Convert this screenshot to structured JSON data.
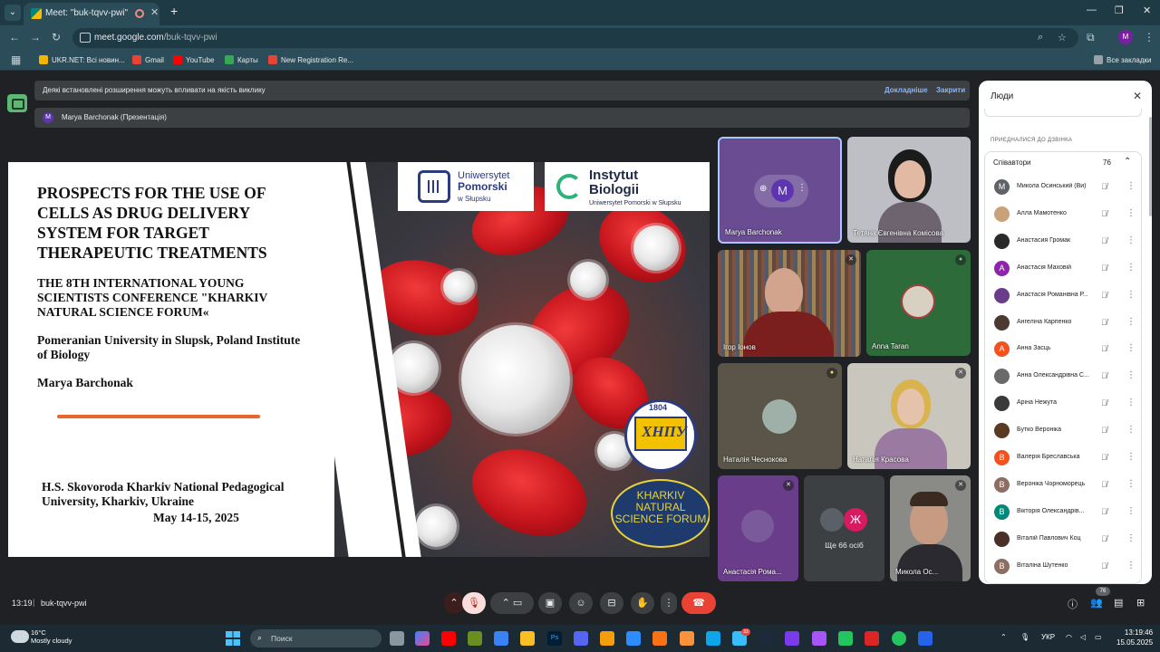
{
  "browser": {
    "tab_title": "Meet: \"buk-tqvv-pwi\"",
    "url_host": "meet.google.com",
    "url_path": "/buk-tqvv-pwi",
    "profile_initial": "M",
    "bookmarks": [
      {
        "label": "UKR.NET: Всі новин...",
        "color": "#f4b400"
      },
      {
        "label": "Gmail",
        "color": "#ea4335"
      },
      {
        "label": "YouTube",
        "color": "#ff0000"
      },
      {
        "label": "Карты",
        "color": "#34a853"
      },
      {
        "label": "New Registration Re...",
        "color": "#ea4335"
      }
    ],
    "all_bookmarks": "Все закладки"
  },
  "meet": {
    "notice_text": "Деякі встановлені розширення можуть впливати на якість виклику",
    "notice_more": "Докладніше",
    "notice_close": "Закрити",
    "presenter_initial": "M",
    "presenter_text": "Marya Barchonak (Презентація)"
  },
  "slide": {
    "title": "PROSPECTS FOR THE USE OF CELLS AS DRUG DELIVERY SYSTEM FOR TARGET THERAPEUTIC TREATMENTS",
    "conference": "THE 8TH INTERNATIONAL YOUNG SCIENTISTS CONFERENCE \"KHARKIV NATURAL SCIENCE FORUM«",
    "university": "Pomeranian University in Slupsk, Poland Institute of Biology",
    "author": "Marya Barchonak",
    "institution": "H.S. Skovoroda Kharkiv National Pedagogical University, Kharkiv, Ukraine",
    "date": "May 14-15, 2025",
    "logo1_line1": "Uniwersytet",
    "logo1_line2": "Pomorski",
    "logo1_line3": "w Słupsku",
    "logo2_line1": "Instytut",
    "logo2_line2": "Biologii",
    "logo2_line3": "Uniwersytet Pomorski w Słupsku",
    "seal_year": "1804",
    "seal_text": "ХНПУ",
    "forum_text": "KHARKIV NATURAL SCIENCE FORUM"
  },
  "tiles": {
    "marya": "Marya Barchonak",
    "marya_initial": "M",
    "tetiana": "Тетяна Євгенівна Комісова",
    "igor": "Ігор Іонов",
    "anna": "Anna Taran",
    "natalia_ch": "Наталія Чеснокова",
    "natalia_kr": "Наталія Красова",
    "anastasia": "Анастасія Рома...",
    "more_label": "Ще 66 осіб",
    "more_initial": "Ж",
    "mykola": "Микола Ос..."
  },
  "people": {
    "title": "Люди",
    "section": "ПРИЄДНАЛИСЯ ДО ДЗВІНКА",
    "group_label": "Співавтори",
    "group_count": "76",
    "list": [
      {
        "name": "Микола Осинський (Ви)",
        "initial": "M",
        "color": "#5f6368"
      },
      {
        "name": "Алла Мамотенко",
        "initial": "",
        "color": "#c9a27a"
      },
      {
        "name": "Анастасия Громак",
        "initial": "",
        "color": "#2a2a2a"
      },
      {
        "name": "Анастасія Маховій",
        "initial": "A",
        "color": "#8e24aa"
      },
      {
        "name": "Анастасія Романівна Р...",
        "initial": "",
        "color": "#6a3d8a"
      },
      {
        "name": "Ангеліна Карпенко",
        "initial": "",
        "color": "#4a3a30"
      },
      {
        "name": "Анна Засць",
        "initial": "A",
        "color": "#f4511e"
      },
      {
        "name": "Анна Олександрівна С...",
        "initial": "",
        "color": "#6a6a6a"
      },
      {
        "name": "Аріна Нежута",
        "initial": "",
        "color": "#3a3a3a"
      },
      {
        "name": "Бутко Вероніка",
        "initial": "",
        "color": "#5a3a20"
      },
      {
        "name": "Валерія Бреславська",
        "initial": "B",
        "color": "#f4511e"
      },
      {
        "name": "Вероніка Чорноморець",
        "initial": "B",
        "color": "#8d6e63"
      },
      {
        "name": "Вікторія Олександрів...",
        "initial": "B",
        "color": "#00897b"
      },
      {
        "name": "Віталій Павлович Коц",
        "initial": "",
        "color": "#4a3028"
      },
      {
        "name": "Віталіна Шутенко",
        "initial": "B",
        "color": "#8d6e63"
      }
    ]
  },
  "controls": {
    "time": "13:19",
    "code": "buk-tqvv-pwi",
    "people_badge": "76"
  },
  "taskbar": {
    "temp": "16°C",
    "weather": "Mostly cloudy",
    "search": "Поиск",
    "lang": "УКР",
    "time": "13:19:46",
    "date": "15.05.2025",
    "badge": "33"
  }
}
